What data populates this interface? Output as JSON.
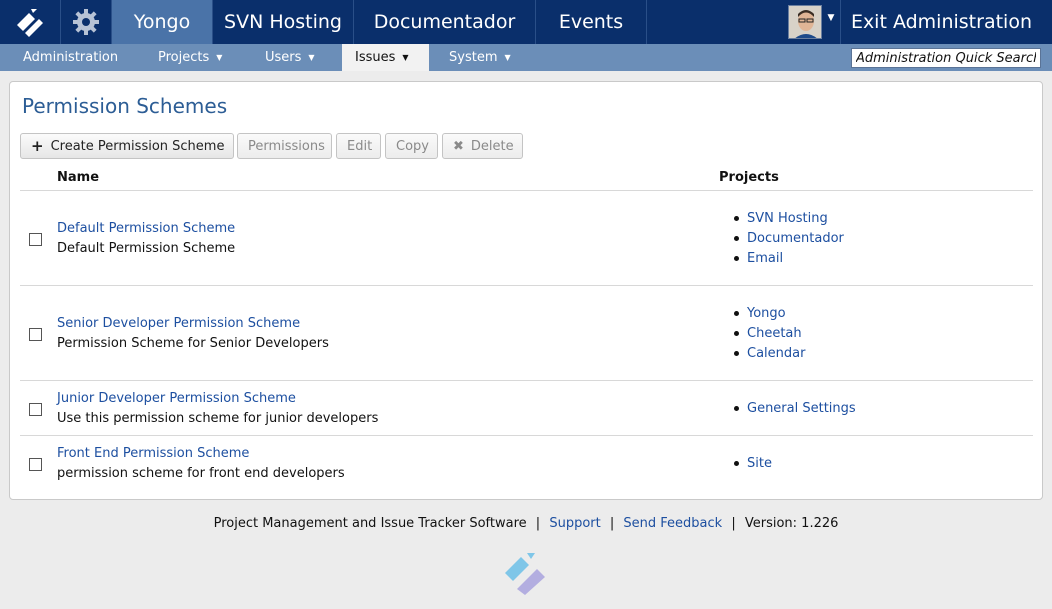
{
  "topbar": {
    "tabs": [
      "Yongo",
      "SVN Hosting",
      "Documentador",
      "Events"
    ],
    "exit_label": "Exit Administration"
  },
  "subbar": {
    "items": [
      "Administration",
      "Projects",
      "Users",
      "Issues",
      "System"
    ],
    "search_value": "Administration Quick Search"
  },
  "page": {
    "title": "Permission Schemes",
    "buttons": {
      "create": "Create Permission Scheme",
      "permissions": "Permissions",
      "edit": "Edit",
      "copy": "Copy",
      "delete": "Delete"
    },
    "columns": {
      "name": "Name",
      "projects": "Projects"
    },
    "rows": [
      {
        "name": "Default Permission Scheme",
        "description": "Default Permission Scheme",
        "projects": [
          "SVN Hosting",
          "Documentador",
          "Email"
        ]
      },
      {
        "name": "Senior Developer Permission Scheme",
        "description": "Permission Scheme for Senior Developers",
        "projects": [
          "Yongo",
          "Cheetah",
          "Calendar"
        ]
      },
      {
        "name": "Junior Developer Permission Scheme",
        "description": "Use this permission scheme for junior developers",
        "projects": [
          "General Settings"
        ]
      },
      {
        "name": "Front End Permission Scheme",
        "description": "permission scheme for front end developers",
        "projects": [
          "Site"
        ]
      }
    ]
  },
  "footer": {
    "text": "Project Management and Issue Tracker Software",
    "sep": "|",
    "support": "Support",
    "feedback": "Send Feedback",
    "version": "Version: 1.226"
  },
  "colors": {
    "topbar": "#0a2f6b",
    "active_tab": "#4a73a8",
    "subbar": "#6b8eb8",
    "link": "#1d4fa0",
    "title": "#2c5d95"
  }
}
